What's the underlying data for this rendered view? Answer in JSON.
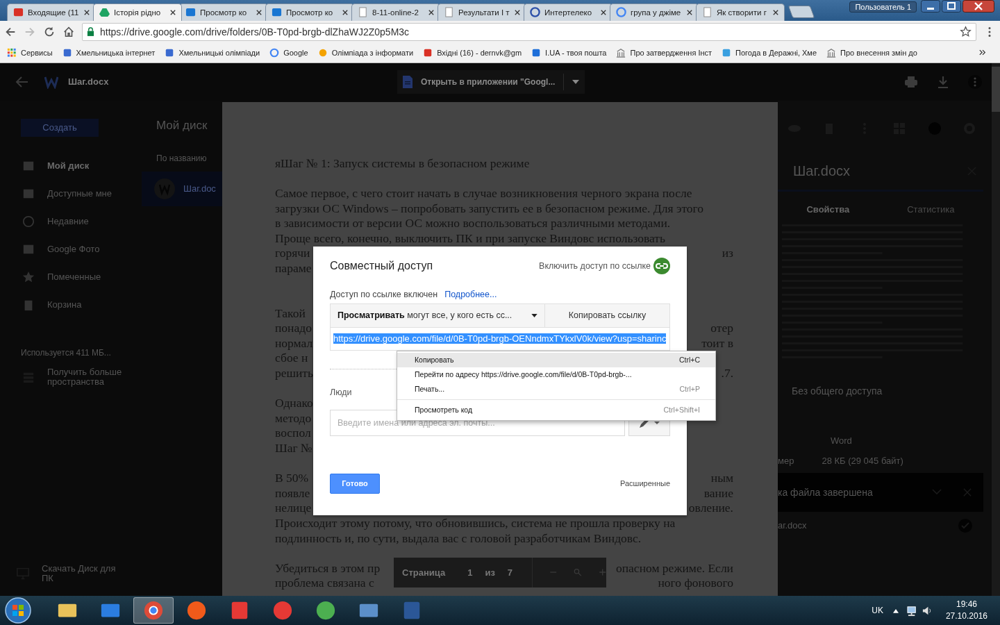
{
  "browser": {
    "tabs": [
      {
        "title": "Входящие (11",
        "selected": false
      },
      {
        "title": "Історія рідно",
        "selected": true
      },
      {
        "title": "Просмотр ко",
        "selected": false
      },
      {
        "title": "Просмотр ко",
        "selected": false
      },
      {
        "title": "8-11-online-2",
        "selected": false
      },
      {
        "title": "Результати І т",
        "selected": false
      },
      {
        "title": "Интертелеко",
        "selected": false
      },
      {
        "title": "група у джіме",
        "selected": false
      },
      {
        "title": "Як створити г",
        "selected": false
      }
    ],
    "profile": "Пользователь 1",
    "address": "https://drive.google.com/drive/folders/0B-T0pd-brgb-dlZhaWJ2Z0p5M3c",
    "bookmarks": [
      "Сервисы",
      "Хмельницька інтернет",
      "Хмельницькі олімпіади",
      "Google",
      "Олімпіада з інформати",
      "Вхідні (16) - dernvk@gm",
      "I.UA - твоя пошта",
      "Про затвердження Інст",
      "Погода в Деражні, Хме",
      "Про внесення змін до"
    ]
  },
  "drive": {
    "create_button": "Создать",
    "breadcrumb": "Мой диск",
    "sort": "По названию",
    "file_card": "Шаг.doc",
    "nav": [
      {
        "label": "Мой диск",
        "selected": true
      },
      {
        "label": "Доступные мне",
        "selected": false
      },
      {
        "label": "Недавние",
        "selected": false
      },
      {
        "label": "Google Фото",
        "selected": false
      },
      {
        "label": "Помеченные",
        "selected": false
      },
      {
        "label": "Корзина",
        "selected": false
      }
    ],
    "storage": "Используется 411 МБ...",
    "upgrade": "Получить больше пространства",
    "download_app": "Скачать Диск для ПК",
    "details": {
      "title": "Шаг.docx",
      "tabs": [
        {
          "label": "Свойства",
          "selected": true
        },
        {
          "label": "Статистика",
          "selected": false
        }
      ],
      "sharing": "Без общего доступа",
      "type_value": "Word",
      "size_label": "мер",
      "size_value": "28 КБ (29 045 байт)",
      "upload_title": "ка файла завершена",
      "upload_file": "аг.docx"
    }
  },
  "viewer": {
    "file_name": "Шаг.docx",
    "open_with": "Открыть в приложении \"Googl...",
    "paragraphs": [
      [
        {
          "text": "яШаг № 1: Запуск системы в безопасном режиме"
        }
      ],
      [
        {
          "text": "Самое первое, с чего стоит начать в случае возникновения черного экрана после"
        },
        {
          "text": "загрузки ОС Windows – попробовать запустить ее в безопасном режиме. Для этого"
        },
        {
          "text": "в зависимости от версии ОС можно воспользоваться различными методами."
        },
        {
          "text": "Проще всего, конечно, выключить ПК и при запуске Виндовс использовать"
        },
        {
          "text": "горячи",
          "right": "из"
        },
        {
          "text": "параме"
        }
      ],
      [
        {
          "text": "Такой"
        },
        {
          "text": "понадо",
          "right": "отер"
        },
        {
          "text": "нормал",
          "right": "тоит в"
        },
        {
          "text": "сбое н"
        },
        {
          "text": "решить",
          "right": ".7."
        }
      ],
      [
        {
          "text": "Однако"
        },
        {
          "text": "методо"
        },
        {
          "text": "воспол"
        },
        {
          "text": "Шаг №"
        }
      ],
      [
        {
          "text": "В 50%",
          "right": "ным"
        },
        {
          "text": "появле",
          "right": "вание"
        },
        {
          "text": "нелице",
          "right": "овление."
        },
        {
          "text": "Происходит этому потому, что обновившись, система не прошла проверку на"
        },
        {
          "text": "подлинность и, по сути, выдала вас с головой разработчикам Виндовс."
        }
      ],
      [
        {
          "text": "Убедиться в этом пр",
          "right": "опасном режиме. Если"
        },
        {
          "text": "проблема связана с",
          "right": "ного фонового"
        }
      ]
    ],
    "page_toolbar": {
      "label": "Страница",
      "current": "1",
      "of": "из",
      "total": "7"
    }
  },
  "share_dialog": {
    "title": "Совместный доступ",
    "link_toggle": "Включить доступ по ссылке",
    "status": "Доступ по ссылке включен",
    "more_link": "Подробнее...",
    "access_dropdown": "**Просматривать** могут все, у кого есть сс...",
    "copy_button": "Копировать ссылку",
    "url": "https://drive.google.com/file/d/0B-T0pd-brgb-OENndmxTYkxlV0k/view?usp=sharinc",
    "people_label": "Люди",
    "people_placeholder": "Введите имена или адреса эл. почты...",
    "done_button": "Готово",
    "advanced_link": "Расширенные"
  },
  "context_menu": {
    "items": [
      {
        "label": "Копировать",
        "shortcut": "Ctrl+C",
        "highlighted": true,
        "separator_before": false
      },
      {
        "label": "Перейти по адресу https://drive.google.com/file/d/0B-T0pd-brgb-...",
        "highlighted": false,
        "separator_before": false
      },
      {
        "label": "Печать...",
        "shortcut": "Ctrl+P",
        "highlighted": false,
        "separator_before": false
      },
      {
        "label": "Просмотреть код",
        "shortcut": "Ctrl+Shift+I",
        "highlighted": false,
        "separator_before": true
      }
    ]
  },
  "taskbar": {
    "apps": [
      {
        "kind": "explorer",
        "selected": false
      },
      {
        "kind": "media",
        "selected": false
      },
      {
        "kind": "chrome",
        "selected": true
      },
      {
        "kind": "reel",
        "selected": false
      },
      {
        "kind": "yabrowser",
        "selected": false
      },
      {
        "kind": "yandex",
        "selected": false
      },
      {
        "kind": "torrent",
        "selected": false
      },
      {
        "kind": "monitor",
        "selected": false
      },
      {
        "kind": "word",
        "selected": false
      }
    ],
    "language": "UK",
    "time": "19:46",
    "date": "27.10.2016"
  }
}
